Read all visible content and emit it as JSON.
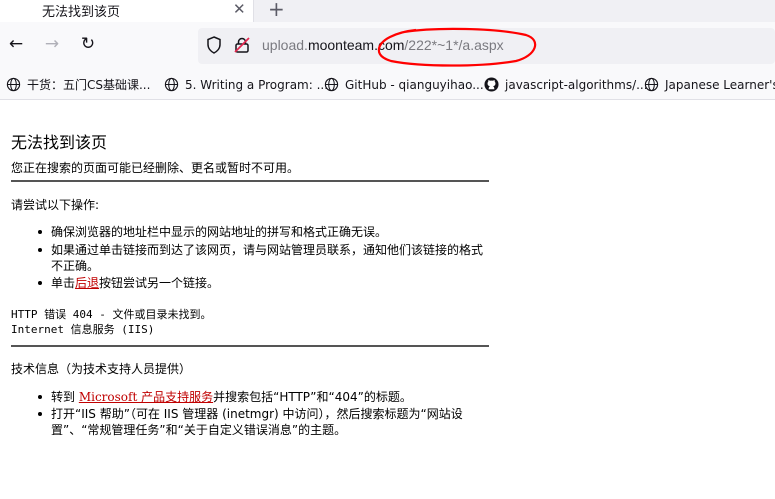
{
  "tab": {
    "title": "无法找到该页",
    "close": "✕",
    "new_tab": "+"
  },
  "nav": {
    "back": "←",
    "forward": "→",
    "reload": "↻",
    "url_prefix": "upload.",
    "url_host": "moonteam.com",
    "url_path": "/222*~1*/a.aspx"
  },
  "bookmarks": [
    {
      "label": "干货：五门CS基础课...",
      "icon": "globe-icon"
    },
    {
      "label": "5. Writing a Program: ...",
      "icon": "globe-icon"
    },
    {
      "label": "GitHub - qianguyihao...",
      "icon": "globe-icon"
    },
    {
      "label": "javascript-algorithms/...",
      "icon": "github-icon"
    },
    {
      "label": "Japanese Learner's Di",
      "icon": "globe-icon"
    }
  ],
  "page": {
    "title": "无法找到该页",
    "intro": "您正在搜索的页面可能已经删除、更名或暂时不可用。",
    "try_heading": "请尝试以下操作:",
    "try_items": [
      "确保浏览器的地址栏中显示的网站地址的拼写和格式正确无误。",
      "如果通过单击链接而到达了该网页，请与网站管理员联系，通知他们该链接的格式不正确。"
    ],
    "back_item_before": "单击",
    "back_item_link": "后退",
    "back_item_after": "按钮尝试另一个链接。",
    "error_line": "HTTP 错误 404 - 文件或目录未找到。",
    "server_line": "Internet 信息服务 (IIS)",
    "tech_heading": "技术信息（为技术支持人员提供）",
    "tech_item1_before": "转到 ",
    "tech_item1_link": "Microsoft 产品支持服务",
    "tech_item1_after": "并搜索包括“HTTP”和“404”的标题。",
    "tech_item2": "打开“IIS 帮助”（可在 IIS 管理器 (inetmgr) 中访问），然后搜索标题为“网站设置”、“常规管理任务”和“关于自定义错误消息”的主题。"
  },
  "colors": {
    "annotation": "#ff0000",
    "link": "#c00000"
  }
}
